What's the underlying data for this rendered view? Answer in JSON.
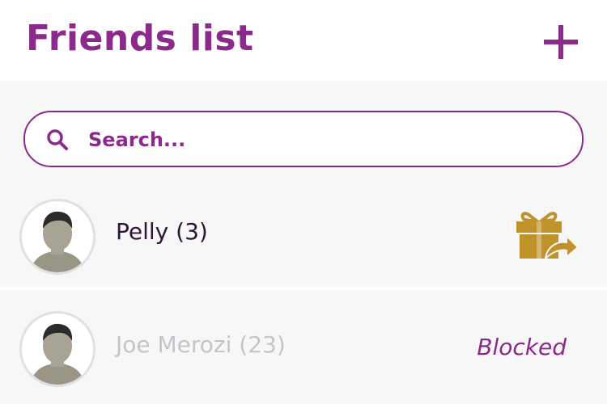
{
  "header": {
    "title": "Friends list",
    "add_icon": "plus-icon"
  },
  "search": {
    "placeholder": "Search...",
    "value": "",
    "icon": "search-icon"
  },
  "friends": [
    {
      "name": "Pelly (3)",
      "avatar_icon": "avatar",
      "action_icon": "gift-send-icon",
      "status": ""
    },
    {
      "name": "Joe Merozi (23)",
      "avatar_icon": "avatar",
      "action_icon": "",
      "status": "Blocked"
    }
  ],
  "colors": {
    "accent": "#8c2a8c",
    "gift": "#c0932a",
    "background": "#f7f7f7",
    "header_bg": "#ffffff",
    "blocked_text": "#c9c2cb"
  }
}
